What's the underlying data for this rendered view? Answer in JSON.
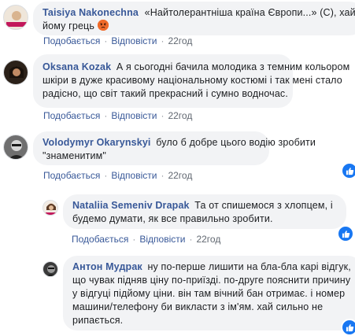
{
  "comments": [
    {
      "author": "Taisiya Nakonechna",
      "text_line1": "«Найтолерантніша країна Європи...» (С), хай",
      "text_line2": "йому грець",
      "emoji": "angry-face-icon",
      "actions": {
        "like": "Подобається",
        "reply": "Відповісти",
        "time": "22год"
      }
    },
    {
      "author": "Oksana Kozak",
      "text_line1": "А я сьогодні бачила молодика з темним кольором",
      "text_line2": "шкіри в дуже красивому національному костюмі і так мені стало",
      "text_line3": "радісно, що світ такий прекрасний і сумно водночас.",
      "actions": {
        "like": "Подобається",
        "reply": "Відповісти",
        "time": "22год"
      }
    },
    {
      "author": "Volodymyr Okarynskyi",
      "text_line1": "було б добре цього водію зробити",
      "text_line2": "\"знаменитим\"",
      "actions": {
        "like": "Подобається",
        "reply": "Відповісти",
        "time": "22год"
      }
    },
    {
      "author": "Nataliia Semeniv Drapak",
      "text_line1": "Та от спишемося з хлопцем, і",
      "text_line2": "будемо думати, як все правильно зробити.",
      "actions": {
        "like": "Подобається",
        "reply": "Відповісти",
        "time": "22год"
      }
    },
    {
      "author": "Антон Мудрак",
      "text_line1": "ну по-перше лишити на бла-бла карі відгук,",
      "text_line2": "що чувак підняв ціну по-приїзді. по-друге пояснити причину",
      "text_line3": "у відгуці підйому ціни. він там вічний бан отримає. і номер",
      "text_line4": "машини/телефону би викласти з ім'ям. хай сильно не",
      "text_line5": "рипається."
    }
  ],
  "colors": {
    "author": "#385898",
    "bubble": "#f2f3f5",
    "like_badge": "#1877f2",
    "meta": "#606770"
  }
}
